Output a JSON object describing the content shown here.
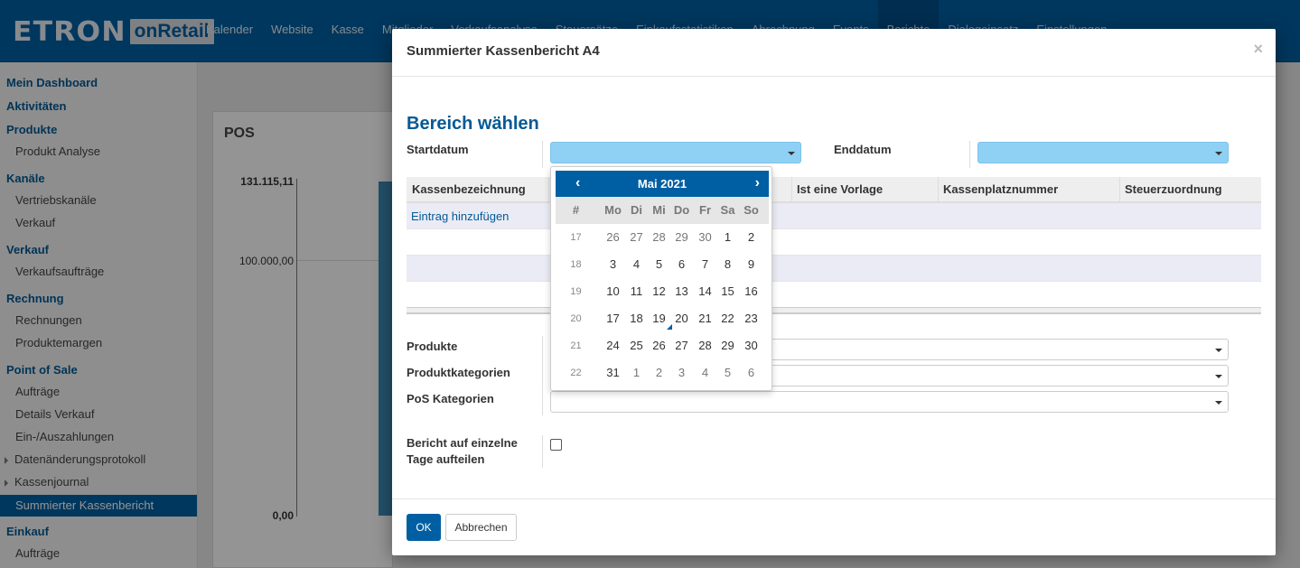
{
  "app": {
    "logo_main": "ETRON",
    "logo_box": "onRetail"
  },
  "topnav": [
    "Kalender",
    "Website",
    "Kasse",
    "Mitglieder",
    "Verkaufsanalyse",
    "Steuersätze",
    "Einkaufsstatistiken",
    "Abrechnung",
    "Events",
    "Berichte",
    "Dialogeinsatz",
    "Einstellungen"
  ],
  "sidebar": {
    "mein_dashboard": "Mein Dashboard",
    "aktivitaeten": "Aktivitäten",
    "produkte": "Produkte",
    "produkt_analyse": "Produkt Analyse",
    "kanaele": "Kanäle",
    "vertriebskanaele": "Vertriebskanäle",
    "verkauf_item": "Verkauf",
    "verkauf": "Verkauf",
    "verkaufsauftraege": "Verkaufsaufträge",
    "rechnung": "Rechnung",
    "rechnungen": "Rechnungen",
    "produktemargen": "Produktemargen",
    "point_of_sale": "Point of Sale",
    "auftraege": "Aufträge",
    "details_verkauf": "Details Verkauf",
    "ein_auszahlungen": "Ein-/Auszahlungen",
    "datenaenderungsprotokoll": "Datenänderungsprotokoll",
    "kassenjournal": "Kassenjournal",
    "summierter_kassenbericht": "Summierter Kassenbericht",
    "einkauf": "Einkauf",
    "einkauf_auftraege": "Aufträge"
  },
  "background": {
    "pos_title": "POS",
    "y_labels": [
      "131.115,11",
      "100.000,00",
      "0,00"
    ]
  },
  "chart_data": {
    "type": "bar",
    "title": "POS",
    "categories": [
      ""
    ],
    "values": [
      131115.11
    ],
    "ylim": [
      0,
      131115.11
    ],
    "ticks": [
      "131.115,11",
      "100.000,00",
      "0,00"
    ]
  },
  "modal": {
    "title": "Summierter Kassenbericht A4",
    "close": "×",
    "subtitle": "Bereich wählen",
    "startdatum_label": "Startdatum",
    "enddatum_label": "Enddatum",
    "table": {
      "columns": [
        "Kassenbezeichnung",
        "",
        "Ist eine Vorlage",
        "Kassenplatznummer",
        "Steuerzuordnung"
      ],
      "add_link": "Eintrag hinzufügen"
    },
    "produkte_label": "Produkte",
    "produktkategorien_label": "Produktkategorien",
    "pos_kategorien_label": "PoS Kategorien",
    "split_label_1": "Bericht auf einzelne",
    "split_label_2": "Tage aufteilen",
    "ok_label": "OK",
    "cancel_label": "Abbrechen"
  },
  "datepicker": {
    "prev": "‹",
    "next": "›",
    "month_label": "Mai 2021",
    "weekday_headers": [
      "#",
      "Mo",
      "Di",
      "Mi",
      "Do",
      "Fr",
      "Sa",
      "So"
    ],
    "weeks": [
      {
        "wk": "17",
        "days": [
          "26",
          "27",
          "28",
          "29",
          "30",
          "1",
          "2"
        ]
      },
      {
        "wk": "18",
        "days": [
          "3",
          "4",
          "5",
          "6",
          "7",
          "8",
          "9"
        ]
      },
      {
        "wk": "19",
        "days": [
          "10",
          "11",
          "12",
          "13",
          "14",
          "15",
          "16"
        ]
      },
      {
        "wk": "20",
        "days": [
          "17",
          "18",
          "19",
          "20",
          "21",
          "22",
          "23"
        ]
      },
      {
        "wk": "21",
        "days": [
          "24",
          "25",
          "26",
          "27",
          "28",
          "29",
          "30"
        ]
      },
      {
        "wk": "22",
        "days": [
          "31",
          "1",
          "2",
          "3",
          "4",
          "5",
          "6"
        ]
      }
    ],
    "today": "19",
    "colors": {
      "header": "#005fa3",
      "selected_input": "#8fd0f5"
    }
  }
}
